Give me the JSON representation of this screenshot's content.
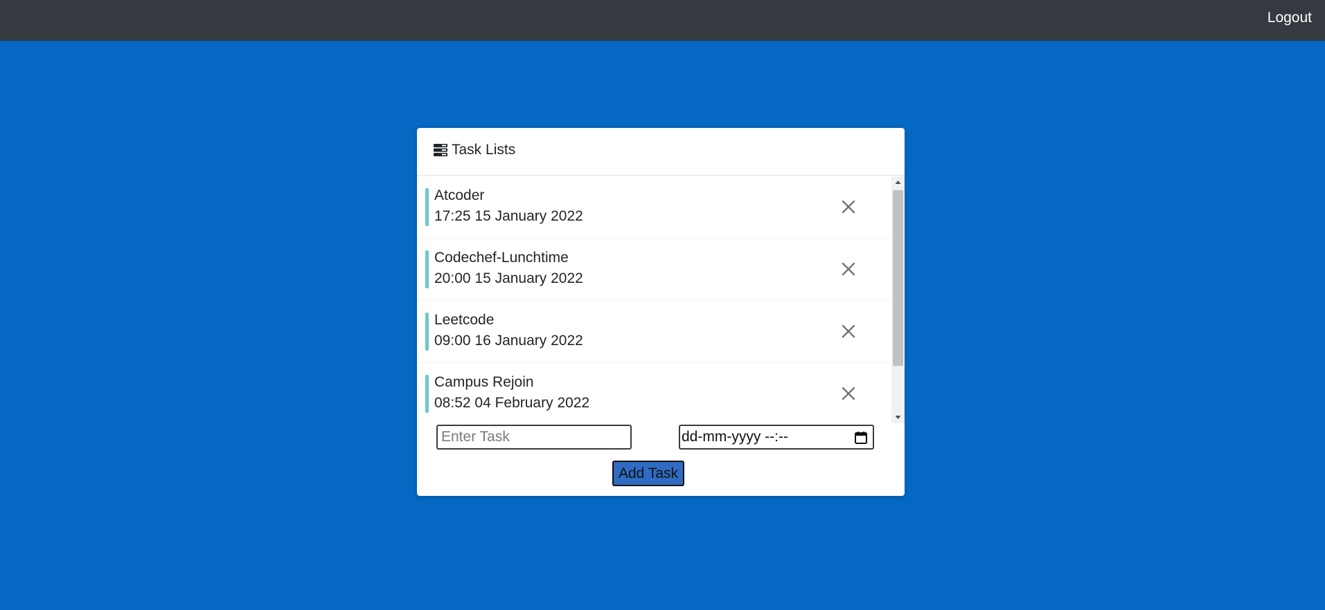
{
  "navbar": {
    "logout_label": "Logout"
  },
  "card": {
    "title": "Task Lists",
    "title_icon": "list-icon",
    "tasks": [
      {
        "name": "Atcoder",
        "time": "17:25 15 January 2022",
        "delete_icon": "close-icon"
      },
      {
        "name": "Codechef-Lunchtime",
        "time": "20:00 15 January 2022",
        "delete_icon": "close-icon"
      },
      {
        "name": "Leetcode",
        "time": "09:00 16 January 2022",
        "delete_icon": "close-icon"
      },
      {
        "name": "Campus Rejoin",
        "time": "08:52 04 February 2022",
        "delete_icon": "close-icon"
      }
    ],
    "task_input": {
      "placeholder": "Enter Task",
      "value": ""
    },
    "date_input": {
      "value": "dd-mm-yyyy --:--",
      "icon": "calendar-icon"
    },
    "add_button_label": "Add Task"
  },
  "colors": {
    "page_background": "#0568c2",
    "navbar_background": "#343a40",
    "accent_bar": "#6ec9cd",
    "button_background": "#2f6bc2"
  }
}
